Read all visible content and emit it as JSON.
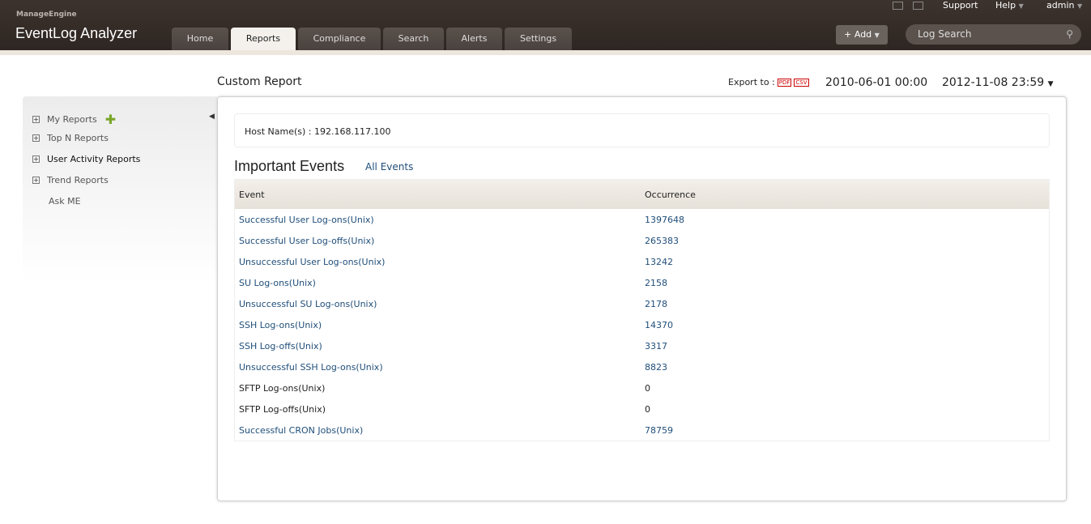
{
  "header": {
    "brand_small": "ManageEngine",
    "product": "EventLog Analyzer",
    "tabs": [
      {
        "label": "Home"
      },
      {
        "label": "Reports"
      },
      {
        "label": "Compliance"
      },
      {
        "label": "Search"
      },
      {
        "label": "Alerts"
      },
      {
        "label": "Settings"
      }
    ],
    "support": "Support",
    "help": "Help",
    "user": "admin",
    "add_label": "+ Add",
    "search_placeholder": "Log Search"
  },
  "page": {
    "title": "Custom Report",
    "export_label": "Export to :",
    "pdf": "PDF",
    "csv": "CSV",
    "date_from": "2010-06-01 00:00",
    "date_to": "2012-11-08 23:59"
  },
  "sidebar": {
    "items": [
      {
        "label": "My Reports"
      },
      {
        "label": "Top N Reports"
      },
      {
        "label": "User Activity Reports"
      },
      {
        "label": "Trend Reports"
      },
      {
        "label": "Ask ME"
      }
    ]
  },
  "report": {
    "host": "Host Name(s) : 192.168.117.100",
    "heading": "Important Events",
    "all_events": "All Events",
    "columns": [
      "Event",
      "Occurrence"
    ],
    "rows": [
      {
        "event": "Successful User Log-ons(Unix)",
        "count": "1397648",
        "link": true
      },
      {
        "event": "Successful User Log-offs(Unix)",
        "count": "265383",
        "link": true
      },
      {
        "event": "Unsuccessful User Log-ons(Unix)",
        "count": "13242",
        "link": true
      },
      {
        "event": "SU Log-ons(Unix)",
        "count": "2158",
        "link": true
      },
      {
        "event": "Unsuccessful SU Log-ons(Unix)",
        "count": "2178",
        "link": true
      },
      {
        "event": "SSH Log-ons(Unix)",
        "count": "14370",
        "link": true
      },
      {
        "event": "SSH Log-offs(Unix)",
        "count": "3317",
        "link": true
      },
      {
        "event": "Unsuccessful SSH Log-ons(Unix)",
        "count": "8823",
        "link": true
      },
      {
        "event": "SFTP Log-ons(Unix)",
        "count": "0",
        "link": false
      },
      {
        "event": "SFTP Log-offs(Unix)",
        "count": "0",
        "link": false
      },
      {
        "event": "Successful CRON Jobs(Unix)",
        "count": "78759",
        "link": true
      }
    ]
  }
}
